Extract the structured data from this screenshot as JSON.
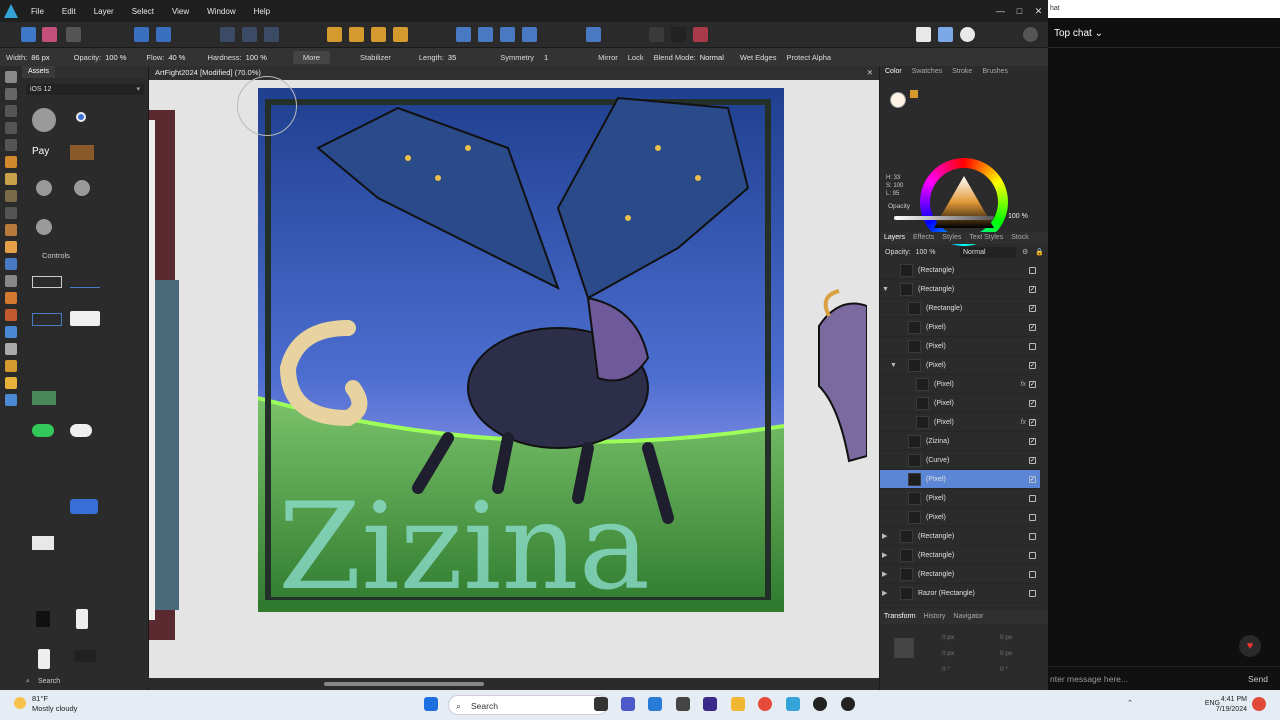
{
  "menubar": {
    "items": [
      "File",
      "Edit",
      "Layer",
      "Select",
      "View",
      "Window",
      "Help"
    ]
  },
  "context_toolbar": {
    "width_label": "Width:",
    "width_value": "86 px",
    "opacity_label": "Opacity:",
    "opacity_value": "100 %",
    "flow_label": "Flow:",
    "flow_value": "40 %",
    "hardness_label": "Hardness:",
    "hardness_value": "100 %",
    "more_label": "More",
    "stabilizer_label": "Stabilizer",
    "length_label": "Length:",
    "length_value": "35",
    "symmetry_label": "Symmetry",
    "symmetry_value": "1",
    "mirror_label": "Mirror",
    "lock_label": "Lock",
    "blend_label": "Blend Mode:",
    "blend_value": "Normal",
    "wet_edges_label": "Wet Edges",
    "protect_alpha_label": "Protect Alpha"
  },
  "assets_panel": {
    "tab": "Assets",
    "category": "iOS 12",
    "controls_header": "Controls",
    "search_placeholder": "Search"
  },
  "document": {
    "tab_title": "ArtFight2024 [Modified] (70.0%)",
    "art_text": "Zizina"
  },
  "color_panel": {
    "tabs": [
      "Color",
      "Swatches",
      "Stroke",
      "Brushes"
    ],
    "h": "H: 33",
    "s": "S: 100",
    "l": "L: 95",
    "opacity_label": "Opacity",
    "opacity_value": "100 %"
  },
  "layers_panel": {
    "tabs": [
      "Layers",
      "Effects",
      "Styles",
      "Text Styles",
      "Stock"
    ],
    "opacity_label": "Opacity:",
    "opacity_value": "100 %",
    "blend_value": "Normal",
    "layers": [
      {
        "name": "(Rectangle)",
        "indent": 0,
        "checked": false,
        "expander": "",
        "fx": false,
        "selected": false
      },
      {
        "name": "(Rectangle)",
        "indent": 0,
        "checked": true,
        "expander": "▼",
        "fx": false,
        "selected": false
      },
      {
        "name": "(Rectangle)",
        "indent": 1,
        "checked": true,
        "expander": "",
        "fx": false,
        "selected": false
      },
      {
        "name": "(Pixel)",
        "indent": 1,
        "checked": true,
        "expander": "",
        "fx": false,
        "selected": false
      },
      {
        "name": "(Pixel)",
        "indent": 1,
        "checked": false,
        "expander": "",
        "fx": false,
        "selected": false
      },
      {
        "name": "(Pixel)",
        "indent": 1,
        "checked": true,
        "expander": "▼",
        "fx": false,
        "selected": false
      },
      {
        "name": "(Pixel)",
        "indent": 2,
        "checked": true,
        "expander": "",
        "fx": true,
        "selected": false
      },
      {
        "name": "(Pixel)",
        "indent": 2,
        "checked": true,
        "expander": "",
        "fx": false,
        "selected": false
      },
      {
        "name": "(Pixel)",
        "indent": 2,
        "checked": true,
        "expander": "",
        "fx": true,
        "selected": false
      },
      {
        "name": "(Zizina)",
        "indent": 1,
        "checked": true,
        "expander": "",
        "fx": false,
        "selected": false
      },
      {
        "name": "(Curve)",
        "indent": 1,
        "checked": true,
        "expander": "",
        "fx": false,
        "selected": false
      },
      {
        "name": "(Pixel)",
        "indent": 1,
        "checked": true,
        "expander": "",
        "fx": false,
        "selected": true
      },
      {
        "name": "(Pixel)",
        "indent": 1,
        "checked": false,
        "expander": "",
        "fx": false,
        "selected": false
      },
      {
        "name": "(Pixel)",
        "indent": 1,
        "checked": false,
        "expander": "",
        "fx": false,
        "selected": false
      },
      {
        "name": "(Rectangle)",
        "indent": 0,
        "checked": false,
        "expander": "▶",
        "fx": false,
        "selected": false
      },
      {
        "name": "(Rectangle)",
        "indent": 0,
        "checked": false,
        "expander": "▶",
        "fx": false,
        "selected": false
      },
      {
        "name": "(Rectangle)",
        "indent": 0,
        "checked": false,
        "expander": "▶",
        "fx": false,
        "selected": false
      },
      {
        "name": "Razor (Rectangle)",
        "indent": 0,
        "checked": false,
        "expander": "▶",
        "fx": false,
        "selected": false
      }
    ]
  },
  "bottom_panel": {
    "tabs": [
      "Transform",
      "History",
      "Navigator"
    ],
    "fields": [
      "0 px",
      "0 px",
      "0 px",
      "0 px",
      "0 °",
      "0 °"
    ]
  },
  "chat": {
    "cut_text": "hat",
    "title": "Top chat",
    "input_placeholder": "nter message here...",
    "send_label": "Send"
  },
  "taskbar": {
    "temperature": "81°F",
    "condition": "Mostly cloudy",
    "search_label": "Search",
    "language": "ENG",
    "time": "4:41 PM",
    "date": "7/19/2024"
  },
  "colors": {
    "accent": "#5b86d6",
    "app_bg": "#2d2d2d",
    "chat_bg": "#0f0f0f"
  }
}
